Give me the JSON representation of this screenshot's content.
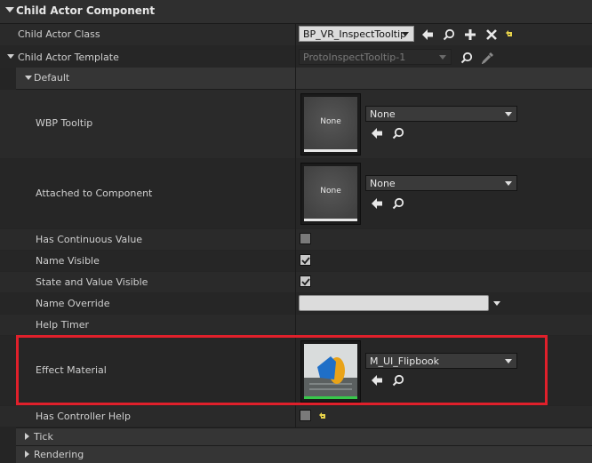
{
  "section": {
    "title": "Child Actor Component"
  },
  "child_actor_class": {
    "label": "Child Actor Class",
    "value": "BP_VR_InspectTooltip"
  },
  "child_actor_template": {
    "label": "Child Actor Template",
    "value": "ProtoInspectTooltip-1"
  },
  "default_group": {
    "label": "Default"
  },
  "wbp_tooltip": {
    "label": "WBP Tooltip",
    "thumb_text": "None",
    "value": "None"
  },
  "attached_to_component": {
    "label": "Attached to Component",
    "thumb_text": "None",
    "value": "None"
  },
  "has_continuous_value": {
    "label": "Has Continuous Value",
    "checked": false
  },
  "name_visible": {
    "label": "Name Visible",
    "checked": true
  },
  "state_and_value_visible": {
    "label": "State and Value Visible",
    "checked": true
  },
  "name_override": {
    "label": "Name Override",
    "value": ""
  },
  "help_timer": {
    "label": "Help Timer"
  },
  "effect_material": {
    "label": "Effect Material",
    "value": "M_UI_Flipbook"
  },
  "has_controller_help": {
    "label": "Has Controller Help",
    "checked": false
  },
  "tick_group": {
    "label": "Tick"
  },
  "rendering_group": {
    "label": "Rendering"
  },
  "colors": {
    "highlight": "#e0202b",
    "accent_green": "#37c84a",
    "reset_arrow": "#e8d34a"
  }
}
